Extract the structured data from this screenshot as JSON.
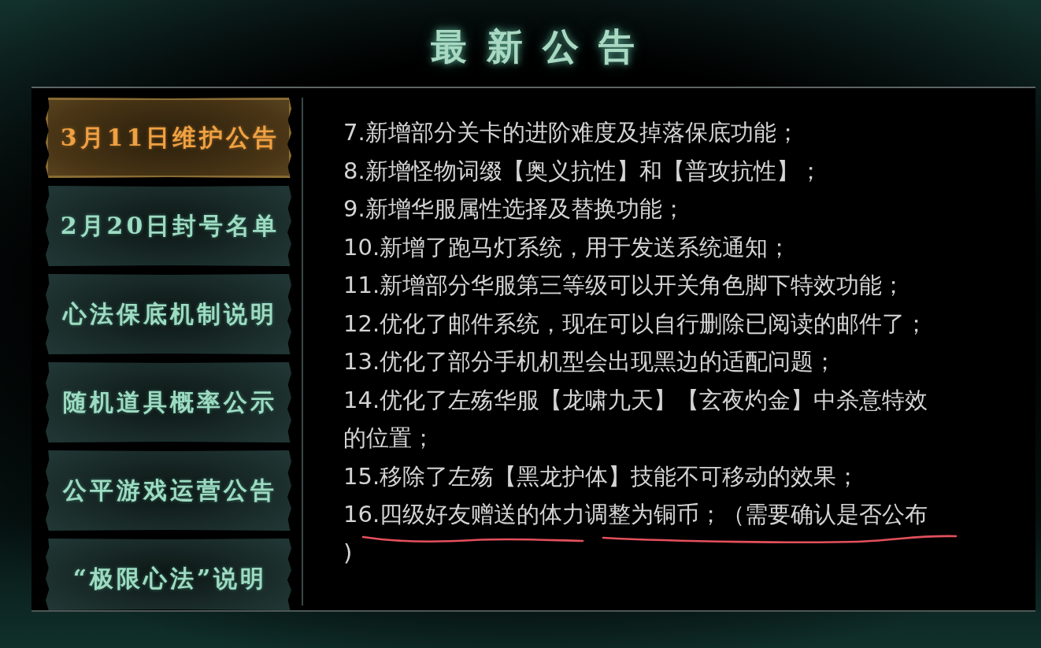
{
  "title": "最新公告",
  "tabs": [
    {
      "label": "3月11日维护公告",
      "selected": true
    },
    {
      "label": "2月20日封号名单",
      "selected": false
    },
    {
      "label": "心法保底机制说明",
      "selected": false
    },
    {
      "label": "随机道具概率公示",
      "selected": false
    },
    {
      "label": "公平游戏运营公告",
      "selected": false
    },
    {
      "label": "“极限心法”说明",
      "selected": false
    }
  ],
  "announcement": {
    "items": [
      {
        "text": "7.新增部分关卡的进阶难度及掉落保底功能；",
        "underlined": false
      },
      {
        "text": "8.新增怪物词缀【奥义抗性】和【普攻抗性】；",
        "underlined": false
      },
      {
        "text": "9.新增华服属性选择及替换功能；",
        "underlined": false
      },
      {
        "text": "10.新增了跑马灯系统，用于发送系统通知；",
        "underlined": false
      },
      {
        "text": "11.新增部分华服第三等级可以开关角色脚下特效功能；",
        "underlined": false
      },
      {
        "text": "12.优化了邮件系统，现在可以自行删除已阅读的邮件了；",
        "underlined": false
      },
      {
        "text": "13.优化了部分手机机型会出现黑边的适配问题；",
        "underlined": false
      },
      {
        "text": "14.优化了左殇华服【龙啸九天】【玄夜灼金】中杀意特效的位置；",
        "underlined": false
      },
      {
        "text": "15.移除了左殇【黑龙护体】技能不可移动的效果；",
        "underlined": false
      },
      {
        "text": "16.四级好友赠送的体力调整为铜币；（需要确认是否公布)",
        "underlined": true
      }
    ]
  }
}
